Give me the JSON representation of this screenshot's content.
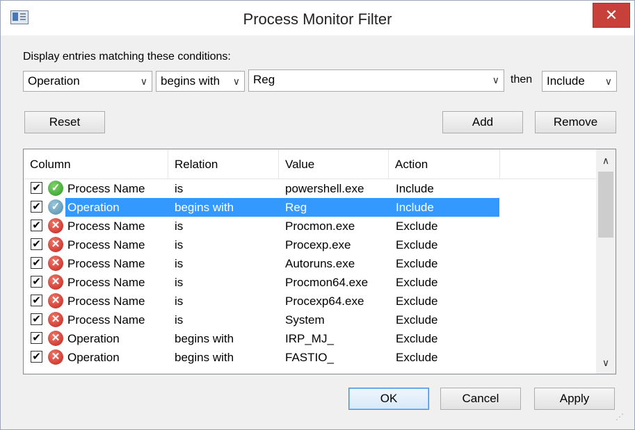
{
  "window": {
    "title": "Process Monitor Filter",
    "close_glyph": "✕"
  },
  "condition": {
    "label": "Display entries matching these conditions:",
    "column_value": "Operation",
    "relation_value": "begins with",
    "value_text": "Reg",
    "then_label": "then",
    "action_value": "Include"
  },
  "buttons": {
    "reset": "Reset",
    "add": "Add",
    "remove": "Remove",
    "ok": "OK",
    "cancel": "Cancel",
    "apply": "Apply"
  },
  "list": {
    "headers": [
      "Column",
      "Relation",
      "Value",
      "Action"
    ],
    "rows": [
      {
        "column": "Process Name",
        "relation": "is",
        "value": "powershell.exe",
        "action": "Include",
        "checked": true,
        "selected": false
      },
      {
        "column": "Operation",
        "relation": "begins with",
        "value": "Reg",
        "action": "Include",
        "checked": true,
        "selected": true
      },
      {
        "column": "Process Name",
        "relation": "is",
        "value": "Procmon.exe",
        "action": "Exclude",
        "checked": true,
        "selected": false
      },
      {
        "column": "Process Name",
        "relation": "is",
        "value": "Procexp.exe",
        "action": "Exclude",
        "checked": true,
        "selected": false
      },
      {
        "column": "Process Name",
        "relation": "is",
        "value": "Autoruns.exe",
        "action": "Exclude",
        "checked": true,
        "selected": false
      },
      {
        "column": "Process Name",
        "relation": "is",
        "value": "Procmon64.exe",
        "action": "Exclude",
        "checked": true,
        "selected": false
      },
      {
        "column": "Process Name",
        "relation": "is",
        "value": "Procexp64.exe",
        "action": "Exclude",
        "checked": true,
        "selected": false
      },
      {
        "column": "Process Name",
        "relation": "is",
        "value": "System",
        "action": "Exclude",
        "checked": true,
        "selected": false
      },
      {
        "column": "Operation",
        "relation": "begins with",
        "value": "IRP_MJ_",
        "action": "Exclude",
        "checked": true,
        "selected": false
      },
      {
        "column": "Operation",
        "relation": "begins with",
        "value": "FASTIO_",
        "action": "Exclude",
        "checked": true,
        "selected": false
      }
    ]
  },
  "icons": {
    "checkbox": "checkbox-checked-icon",
    "include": "green-check-icon",
    "exclude": "red-x-icon",
    "dropdown": "chevron-down-icon",
    "scroll_up": "chevron-up-icon",
    "scroll_down": "chevron-down-icon"
  }
}
